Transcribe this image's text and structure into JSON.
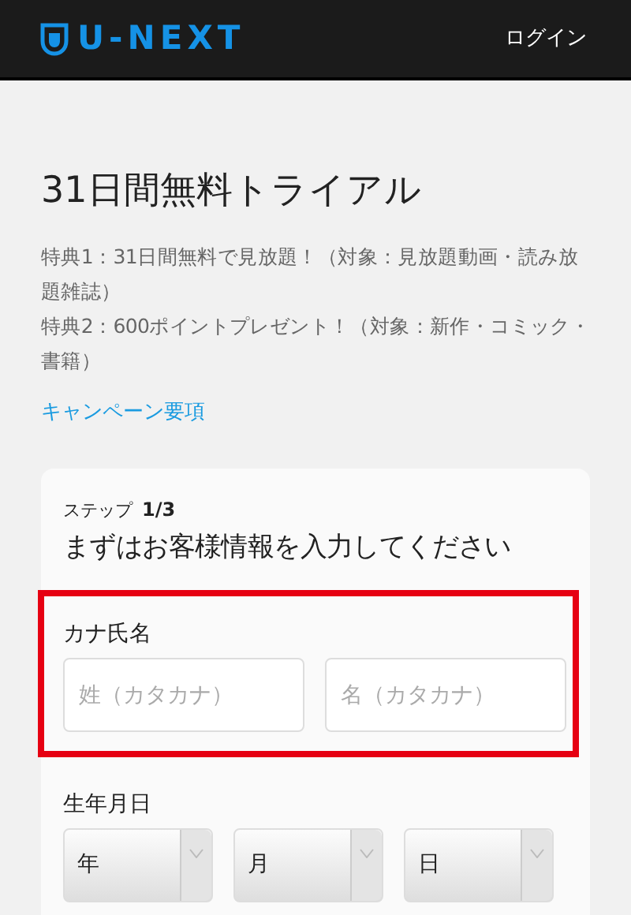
{
  "header": {
    "logo": "U-NEXT",
    "login": "ログイン"
  },
  "title": "31日間無料トライアル",
  "benefits": [
    "特典1：31日間無料で見放題！（対象：見放題動画・読み放題雑誌）",
    "特典2：600ポイントプレゼント！（対象：新作・コミック・書籍）"
  ],
  "campaign_link": "キャンペーン要項",
  "form": {
    "step_label": "ステップ",
    "step": "1/3",
    "heading": "まずはお客様情報を入力してください",
    "kana_name": {
      "label": "カナ氏名",
      "highlighted": true,
      "fields": [
        {
          "placeholder": "姓（カタカナ）"
        },
        {
          "placeholder": "名（カタカナ）"
        }
      ]
    },
    "birthdate": {
      "label": "生年月日",
      "selects": [
        {
          "value": "年"
        },
        {
          "value": "月"
        },
        {
          "value": "日"
        }
      ]
    }
  }
}
